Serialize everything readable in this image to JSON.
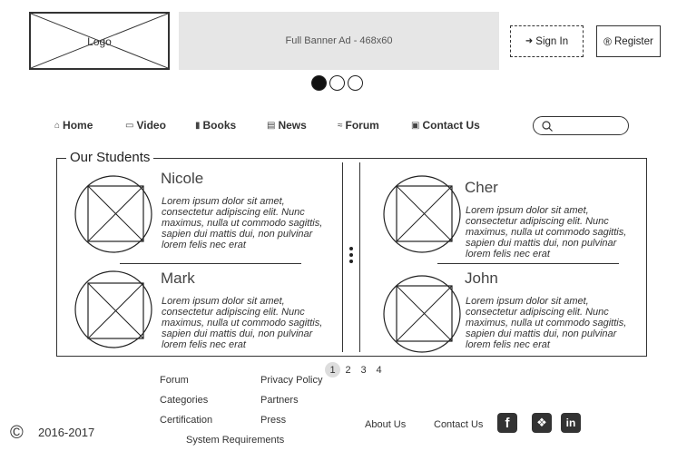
{
  "header": {
    "logo_label": "Logo",
    "banner_label": "Full Banner Ad - 468x60",
    "sign_in_label": "Sign In",
    "register_label": "Register"
  },
  "carousel": {
    "active_index": 0,
    "count": 3
  },
  "nav": {
    "items": [
      {
        "label": "Home",
        "icon": "home-icon"
      },
      {
        "label": "Video",
        "icon": "video-icon"
      },
      {
        "label": "Books",
        "icon": "book-icon"
      },
      {
        "label": "News",
        "icon": "newspaper-icon"
      },
      {
        "label": "Forum",
        "icon": "forum-icon"
      },
      {
        "label": "Contact Us",
        "icon": "id-card-icon"
      }
    ],
    "search_value": ""
  },
  "students": {
    "title": "Our Students",
    "items": [
      {
        "name": "Nicole",
        "desc": "Lorem ipsum dolor sit amet, consectetur adipiscing elit. Nunc maximus, nulla ut commodo sagittis, sapien dui mattis dui, non pulvinar lorem felis nec erat"
      },
      {
        "name": "Mark",
        "desc": "Lorem ipsum dolor sit amet, consectetur adipiscing elit. Nunc maximus, nulla ut commodo sagittis, sapien dui mattis dui, non pulvinar lorem felis nec erat"
      },
      {
        "name": "Cher",
        "desc": "Lorem ipsum dolor sit amet, consectetur adipiscing elit. Nunc maximus, nulla ut commodo sagittis, sapien dui mattis dui, non pulvinar lorem felis nec erat"
      },
      {
        "name": "John",
        "desc": "Lorem ipsum dolor sit amet, consectetur adipiscing elit. Nunc maximus, nulla ut commodo sagittis, sapien dui mattis dui, non pulvinar lorem felis nec erat"
      }
    ]
  },
  "pagination": {
    "pages": [
      "1",
      "2",
      "3",
      "4"
    ],
    "active": "1"
  },
  "footer": {
    "copyright": "2016-2017",
    "links_col1": [
      "Forum",
      "Categories",
      "Certification"
    ],
    "links_col2": [
      "Privacy Policy",
      "Partners",
      "Press"
    ],
    "system_requirements": "System Requirements",
    "about": "About Us",
    "contact": "Contact Us",
    "social_icons": [
      "facebook-icon",
      "twitter-icon",
      "linkedin-icon"
    ]
  }
}
